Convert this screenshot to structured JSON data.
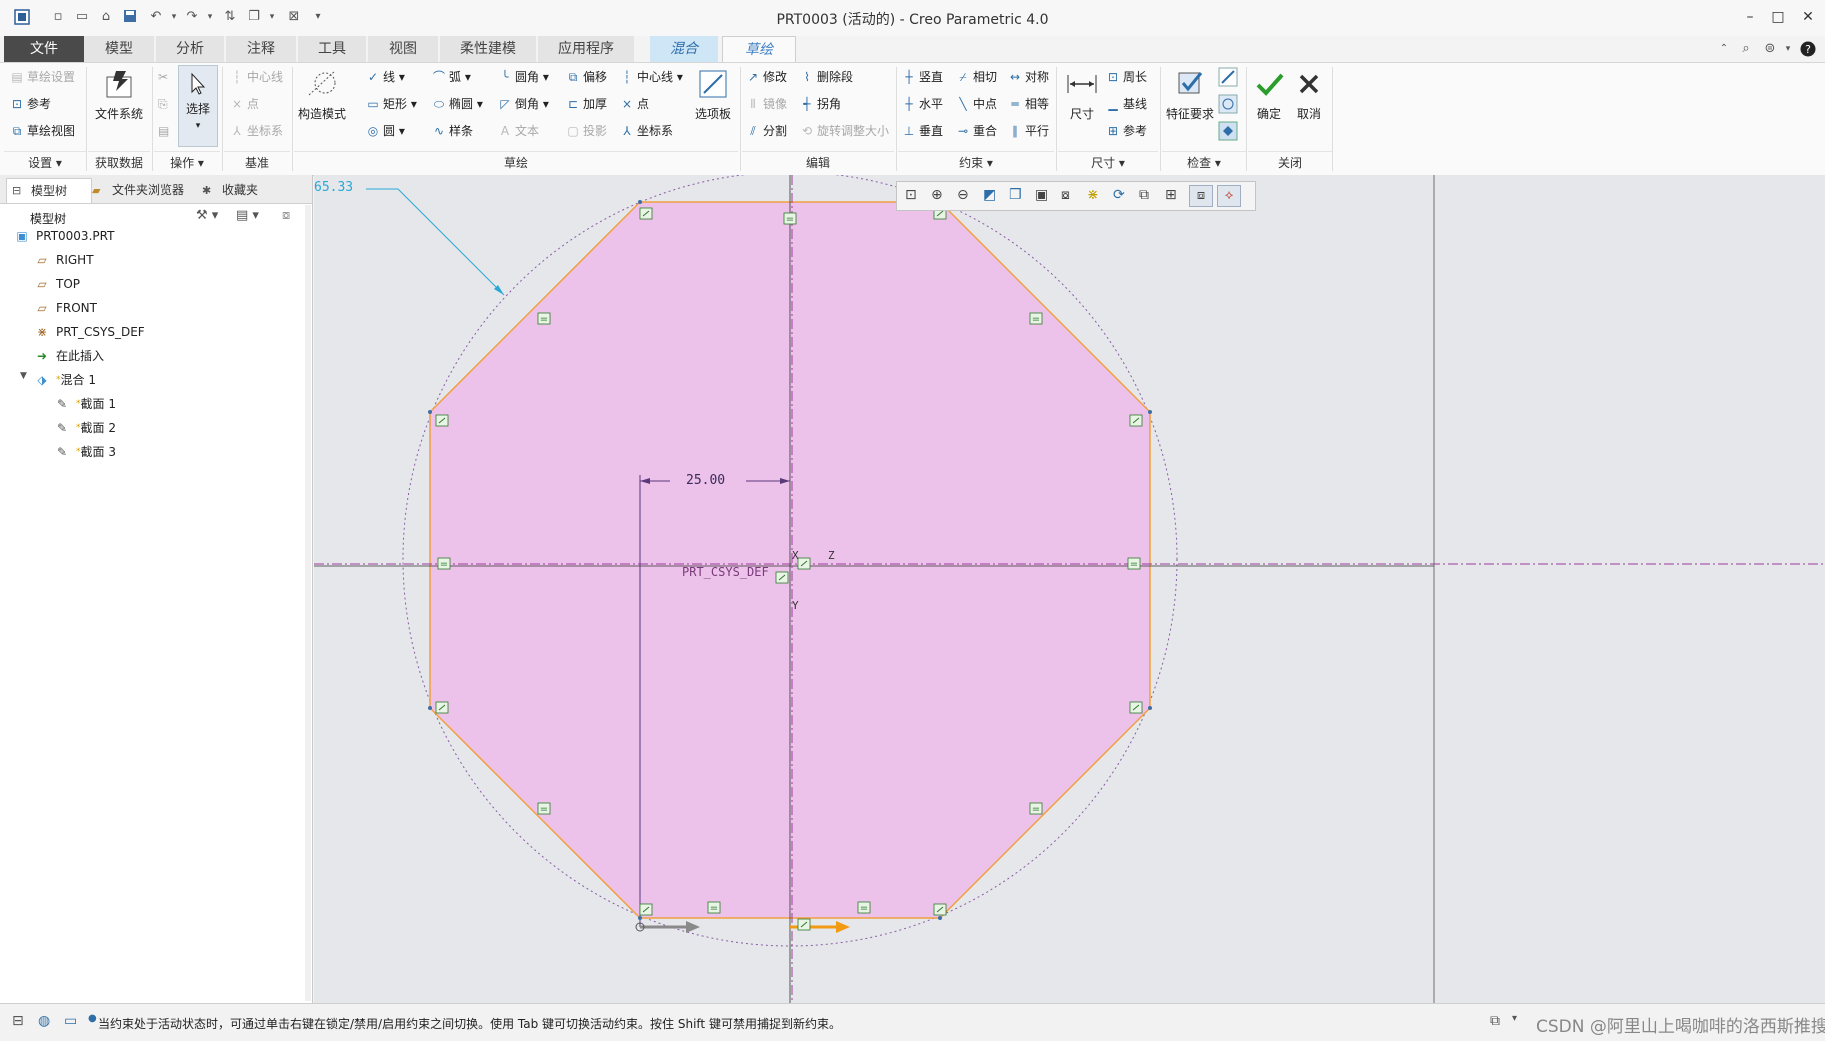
{
  "window": {
    "title": "PRT0003 (活动的) - Creo Parametric 4.0"
  },
  "tabs": [
    {
      "label": "文件"
    },
    {
      "label": "模型"
    },
    {
      "label": "分析"
    },
    {
      "label": "注释"
    },
    {
      "label": "工具"
    },
    {
      "label": "视图"
    },
    {
      "label": "柔性建模"
    },
    {
      "label": "应用程序"
    },
    {
      "label": "混合"
    },
    {
      "label": "草绘"
    }
  ],
  "ribbon": {
    "setup": {
      "sketch_setup": "草绘设置",
      "reference": "参考",
      "sketch_view": "草绘视图",
      "label": "设置"
    },
    "get_data": {
      "file_system": "文件系统",
      "label": "获取数据"
    },
    "operations": {
      "select": "选择",
      "label": "操作"
    },
    "datum": {
      "centerline": "中心线",
      "point": "点",
      "csys": "坐标系",
      "label": "基准"
    },
    "sketch": {
      "construction_mode": "构造模式",
      "line": "线",
      "arc": "弧",
      "fillet": "圆角",
      "offset": "偏移",
      "centerline": "中心线",
      "rectangle": "矩形",
      "ellipse": "椭圆",
      "chamfer": "倒角",
      "thicken": "加厚",
      "point": "点",
      "circle": "圆",
      "spline": "样条",
      "text": "文本",
      "project": "投影",
      "csys": "坐标系",
      "palette": "选项板",
      "label": "草绘"
    },
    "edit": {
      "modify": "修改",
      "delete_segment": "删除段",
      "mirror": "镜像",
      "corner": "拐角",
      "divide": "分割",
      "rotate_resize": "旋转调整大小",
      "label": "编辑"
    },
    "constrain": {
      "vertical": "竖直",
      "tangent": "相切",
      "symmetric": "对称",
      "horizontal": "水平",
      "midpoint": "中点",
      "equal": "相等",
      "perpendicular": "垂直",
      "coincident": "重合",
      "parallel": "平行",
      "label": "约束"
    },
    "dimension": {
      "dimension": "尺寸",
      "perimeter": "周长",
      "baseline": "基线",
      "reference": "参考",
      "label": "尺寸"
    },
    "inspect": {
      "feature_requirements": "特征要求",
      "label": "检查"
    },
    "close": {
      "ok": "确定",
      "cancel": "取消",
      "label": "关闭"
    }
  },
  "left_panel": {
    "tabs": [
      {
        "label": "模型树"
      },
      {
        "label": "文件夹浏览器"
      },
      {
        "label": "收藏夹"
      }
    ],
    "tree_title": "模型树",
    "tree": [
      {
        "label": "PRT0003.PRT"
      },
      {
        "label": "RIGHT"
      },
      {
        "label": "TOP"
      },
      {
        "label": "FRONT"
      },
      {
        "label": "PRT_CSYS_DEF"
      },
      {
        "label": "在此插入"
      },
      {
        "label": "混合 1"
      },
      {
        "label": "截面 1"
      },
      {
        "label": "截面 2"
      },
      {
        "label": "截面 3"
      }
    ]
  },
  "canvas": {
    "dim_diameter": "65.33",
    "dim_horizontal": "25.00",
    "csys_label": "PRT_CSYS_DEF",
    "axis_x": "X",
    "axis_y": "Y",
    "axis_z": "Z",
    "fill_color": "#edc2ea",
    "edge_color": "#f0a040"
  },
  "status": {
    "message": "当约束处于活动状态时，可通过单击右键在锁定/禁用/启用约束之间切换。使用 Tab 键可切换活动约束。按住 Shift 键可禁用捕捉到新约束。",
    "watermark": "CSDN @阿里山上喝咖啡的洛西斯推搜"
  }
}
